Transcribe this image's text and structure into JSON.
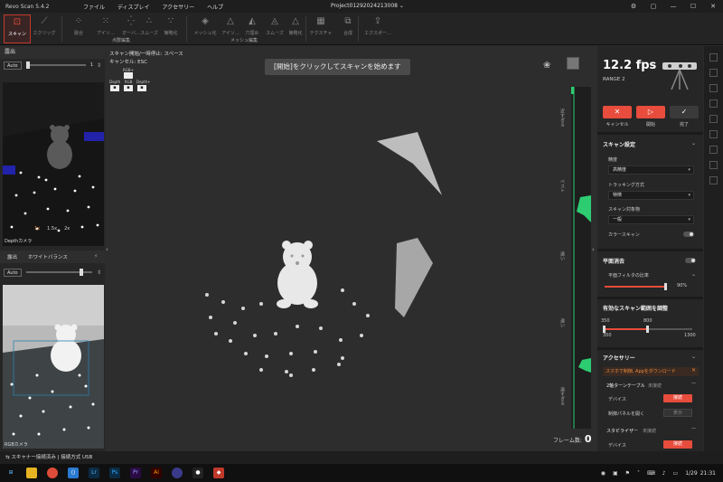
{
  "titlebar": {
    "app_name": "Revo Scan 5.4.2",
    "menu": [
      "ファイル",
      "ディスプレイ",
      "アクセサリー",
      "ヘルプ"
    ],
    "project": "Project01292024213008 ⌄"
  },
  "ribbon": {
    "buttons": [
      {
        "label": "スキャン",
        "icon": "scanner-icon"
      },
      {
        "label": "エクリッグ",
        "icon": "wand-icon"
      },
      {
        "label": "融合",
        "icon": "fusion-icon"
      },
      {
        "label": "アイソ…",
        "icon": "isolation-icon"
      },
      {
        "label": "オーバ…",
        "icon": "overlap-icon"
      },
      {
        "label": "スムーズ",
        "icon": "smooth-icon"
      },
      {
        "label": "簡略化",
        "icon": "simplify-icon"
      },
      {
        "label": "メッシュ化",
        "icon": "mesh-icon"
      },
      {
        "label": "アイソ…",
        "icon": "isolation-icon"
      },
      {
        "label": "穴埋め",
        "icon": "fill-hole-icon"
      },
      {
        "label": "スムーズ",
        "icon": "smooth-icon"
      },
      {
        "label": "簡略化",
        "icon": "simplify-icon"
      },
      {
        "label": "テクスチャ",
        "icon": "texture-icon"
      },
      {
        "label": "合成",
        "icon": "merge-icon"
      },
      {
        "label": "エクスポー…",
        "icon": "export-icon"
      }
    ],
    "section_points": "点群編集",
    "section_mesh": "メッシュ編集"
  },
  "left": {
    "exposure_title": "露出",
    "auto_label": "Auto",
    "exposure_value": "1",
    "depth_camera_label": "Depthカメラ",
    "zoom": [
      "1x",
      "1.5x",
      "2x"
    ],
    "tab_exposure": "露出",
    "tab_white_balance": "ホワイトバランス",
    "auto2_label": "Auto",
    "rgb_camera_label": "RGBカメラ"
  },
  "viewport": {
    "hint_line1": "スキャン開始/一時停止: スペース",
    "hint_line2": "キャンセル: ESC",
    "mini_rgb": "RGB+",
    "mini_labels": [
      "Depth",
      "RGB",
      "Depth+"
    ],
    "banner": "[開始]をクリックしてスキャンを始めます",
    "frame_label": "フレーム数:",
    "frame_count": "0",
    "depth_labels": [
      "近すぎる",
      "ベスト",
      "遠い",
      "遠い",
      "遠すぎる"
    ]
  },
  "right": {
    "fps": "12.2 fps",
    "range": "RANGE 2",
    "cancel_label": "キャンセル",
    "start_label": "開始",
    "done_label": "完了",
    "settings_title": "スキャン設定",
    "accuracy_label": "精度",
    "accuracy_value": "高精度",
    "tracking_label": "トラッキング方式",
    "tracking_value": "特徴",
    "object_label": "スキャン対象物",
    "object_value": "一般",
    "color_scan_label": "カラースキャン",
    "plane_title": "平面消去",
    "plane_filter_label": "平面フィルタの比率",
    "plane_filter_value": "90%",
    "range_title": "有効なスキャン範囲を調整",
    "range_low": "350",
    "range_high": "800",
    "range_min": "350",
    "range_max": "1300",
    "accessory_title": "アクセサリー",
    "notice": "スマホで制御, Appをダウンロード",
    "turntable_title": "2軸ターンテーブル",
    "turntable_status": "未接続",
    "device_label": "デバイス",
    "connect_label": "接続",
    "panel_label": "制御パネルを開く",
    "display_label": "表示",
    "stabilizer_title": "スタビライザー",
    "stabilizer_status": "未接続",
    "device2_label": "デバイス",
    "connect2_label": "接続"
  },
  "status": {
    "text": "スキャナー接続済み | 接続方式 USB"
  },
  "taskbar": {
    "time": "21:31",
    "date": "1/29"
  },
  "colors": {
    "accent": "#e74c3c",
    "depth_green": "#2ecc71"
  }
}
